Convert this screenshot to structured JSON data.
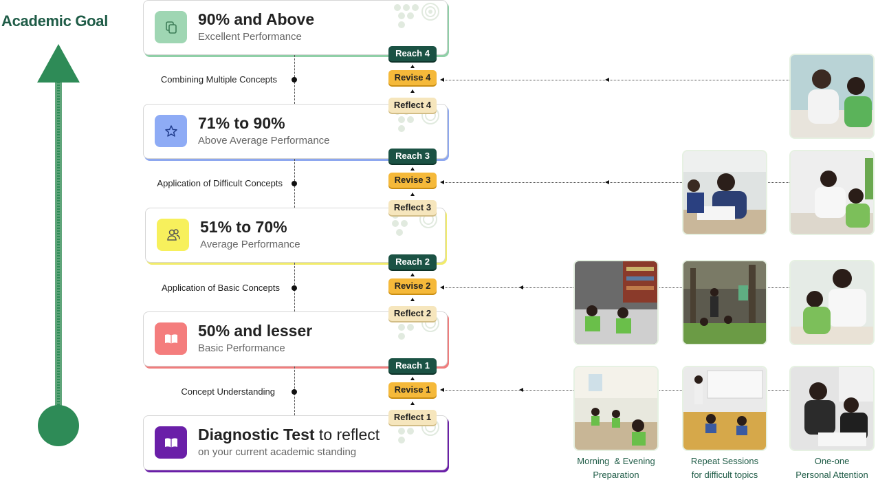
{
  "goal": {
    "title": "Academic Goal"
  },
  "levels": [
    {
      "title": "90% and Above",
      "subtitle": "Excellent Performance",
      "icon": "copy-icon",
      "accent": "#8fcfa7",
      "icon_bg": "#9fd6b3"
    },
    {
      "title": "71% to 90%",
      "subtitle": "Above Average Performance",
      "icon": "star-icon",
      "accent": "#8da7ef",
      "icon_bg": "#8eabf5"
    },
    {
      "title": "51% to 70%",
      "subtitle": "Average Performance",
      "icon": "users-icon",
      "accent": "#f2ec6a",
      "icon_bg": "#f7f05c"
    },
    {
      "title": "50% and lesser",
      "subtitle": "Basic Performance",
      "icon": "book-icon",
      "accent": "#f07d7d",
      "icon_bg": "#f47d7d"
    },
    {
      "title_bold": "Diagnostic Test",
      "title_light": " to reflect",
      "subtitle": "on your current academic standing",
      "icon": "book-icon",
      "accent": "#6a1fa8",
      "icon_bg": "#6a1fa8"
    }
  ],
  "steps": [
    {
      "label": "Combining Multiple Concepts",
      "reach": "Reach 4",
      "revise": "Revise 4",
      "reflect": "Reflect 4"
    },
    {
      "label": "Application of Difficult Concepts",
      "reach": "Reach 3",
      "revise": "Revise 3",
      "reflect": "Reflect 3"
    },
    {
      "label": "Application of Basic Concepts",
      "reach": "Reach 2",
      "revise": "Revise 2",
      "reflect": "Reflect 2"
    },
    {
      "label": "Concept Understanding",
      "reach": "Reach 1",
      "revise": "Revise 1",
      "reflect": "Reflect 1"
    }
  ],
  "captions": [
    {
      "line1": "Morning  & Evening",
      "line2": "Preparation"
    },
    {
      "line1": "Repeat Sessions",
      "line2": "for difficult topics"
    },
    {
      "line1": "One-one",
      "line2": "Personal Attention"
    }
  ],
  "colors": {
    "brand_green": "#1f5c47",
    "arrow_green": "#2e8b57",
    "reach": "#1b5244",
    "revise": "#f5b93a",
    "reflect": "#f6e6bd"
  }
}
